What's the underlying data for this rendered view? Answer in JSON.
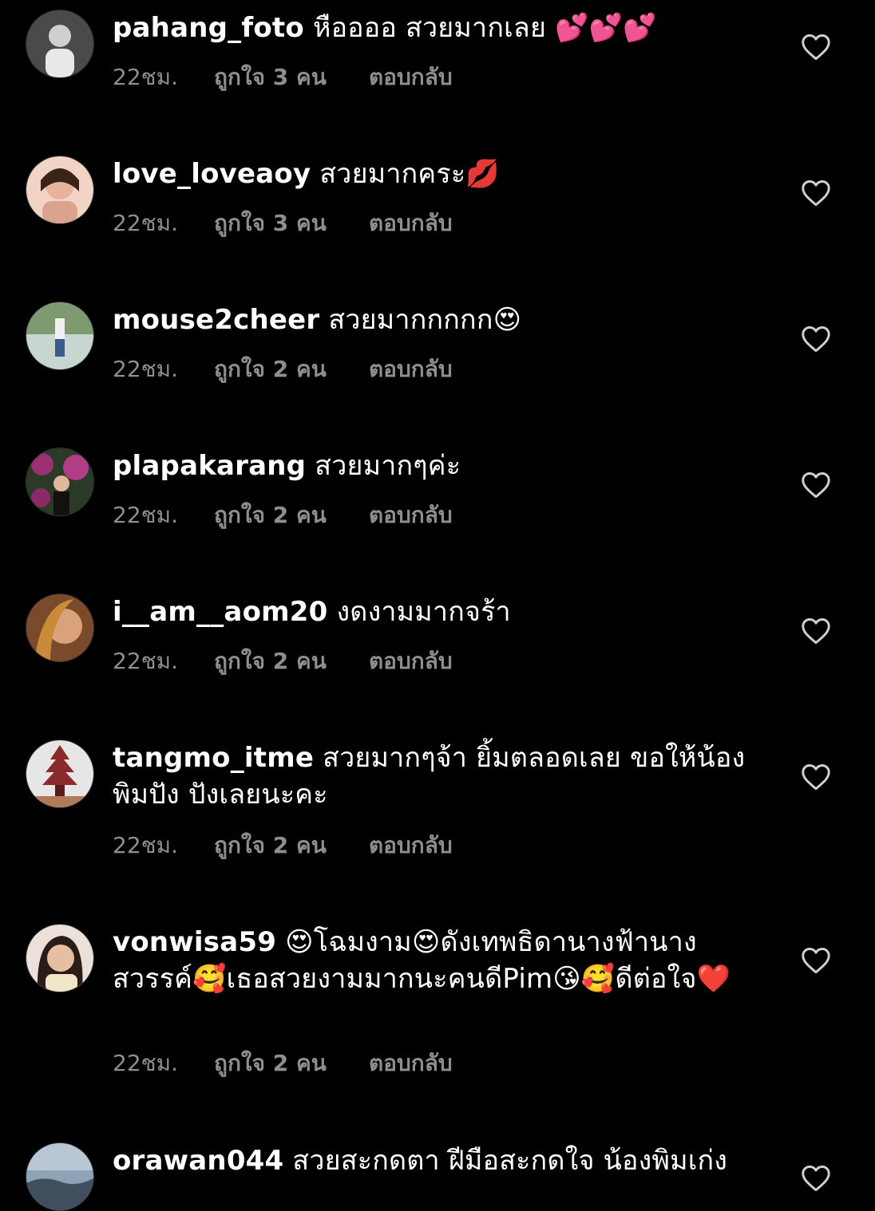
{
  "comments": [
    {
      "username": "pahang_foto",
      "text": "หืออออ สวยมากเลย 💕💕💕",
      "time": "22ชม.",
      "likes": "ถูกใจ 3 คน",
      "reply": "ตอบกลับ",
      "avatar_colors": [
        "#6b6b6b",
        "#cfcfcf"
      ]
    },
    {
      "username": "love_loveaoy",
      "text": "สวยมากคระ💋",
      "time": "22ชม.",
      "likes": "ถูกใจ 3 คน",
      "reply": "ตอบกลับ",
      "avatar_colors": [
        "#e9b7a8",
        "#f4d7c9"
      ]
    },
    {
      "username": "mouse2cheer",
      "text": "สวยมากกกกก😍",
      "time": "22ชม.",
      "likes": "ถูกใจ 2 คน",
      "reply": "ตอบกลับ",
      "avatar_colors": [
        "#5f7d57",
        "#c9d6d0"
      ]
    },
    {
      "username": "plapakarang",
      "text": "สวยมากๆค่ะ",
      "time": "22ชม.",
      "likes": "ถูกใจ 2 คน",
      "reply": "ตอบกลับ",
      "avatar_colors": [
        "#7a2c5c",
        "#2a3a26"
      ]
    },
    {
      "username": "i__am__aom20",
      "text": "งดงามมากจร้า",
      "time": "22ชม.",
      "likes": "ถูกใจ 2 คน",
      "reply": "ตอบกลับ",
      "avatar_colors": [
        "#b47a3c",
        "#5a3a22"
      ]
    },
    {
      "username": "tangmo_itme",
      "text": "สวยมากๆจ้า ยิ้มตลอดเลย ขอให้น้องพิมปัง ปังเลยนะคะ",
      "time": "22ชม.",
      "likes": "ถูกใจ 2 คน",
      "reply": "ตอบกลับ",
      "avatar_colors": [
        "#e6e6e6",
        "#8b2a2a"
      ]
    },
    {
      "username": "vonwisa59",
      "text": "😍โฉมงาม😍ดังเทพธิดานางฟ้านางสวรรค์🥰เธอสวยงามมากนะคนดีPim😘🥰ดีต่อใจ❤️",
      "time": "22ชม.",
      "likes": "ถูกใจ 2 คน",
      "reply": "ตอบกลับ",
      "avatar_colors": [
        "#d9c7b8",
        "#3a2a22"
      ]
    },
    {
      "username": "orawan044",
      "text": "สวยสะกดตา ฝีมือสะกดใจ น้องพิมเก่ง",
      "avatar_colors": [
        "#8fa3b6",
        "#3f4f5e"
      ]
    }
  ]
}
